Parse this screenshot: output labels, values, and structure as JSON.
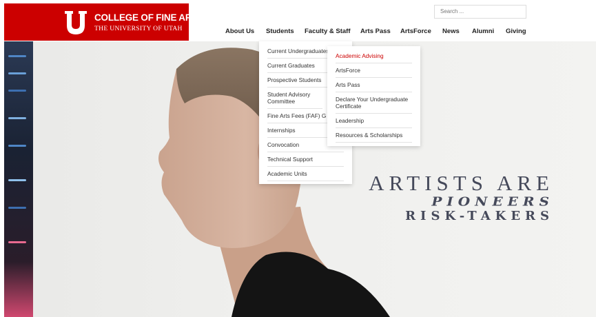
{
  "brand": {
    "title": "COLLEGE OF FINE ARTS",
    "subtitle": "THE UNIVERSITY OF UTAH",
    "color": "#cc0000"
  },
  "search": {
    "placeholder": "Search ..."
  },
  "nav": {
    "items": [
      {
        "label": "About Us"
      },
      {
        "label": "Students"
      },
      {
        "label": "Faculty & Staff"
      },
      {
        "label": "Arts Pass"
      },
      {
        "label": "ArtsForce"
      },
      {
        "label": "News"
      },
      {
        "label": "Alumni"
      },
      {
        "label": "Giving"
      }
    ]
  },
  "students_menu": {
    "items": [
      {
        "label": "Current Undergraduates"
      },
      {
        "label": "Current Graduates"
      },
      {
        "label": "Prospective Students"
      },
      {
        "label": "Student Advisory Committee"
      },
      {
        "label": "Fine Arts Fees (FAF) G"
      },
      {
        "label": "Internships"
      },
      {
        "label": "Convocation"
      },
      {
        "label": "Technical Support"
      },
      {
        "label": "Academic Units"
      }
    ]
  },
  "undergrad_submenu": {
    "items": [
      {
        "label": "Academic Advising",
        "active": true
      },
      {
        "label": "ArtsForce"
      },
      {
        "label": "Arts Pass"
      },
      {
        "label": "Declare Your Undergraduate Certificate"
      },
      {
        "label": "Leadership"
      },
      {
        "label": "Resources & Scholarships"
      }
    ]
  },
  "hero": {
    "line1": "ARTISTS ARE",
    "line2": "PIONEERS",
    "line3": "RISK-TAKERS"
  }
}
